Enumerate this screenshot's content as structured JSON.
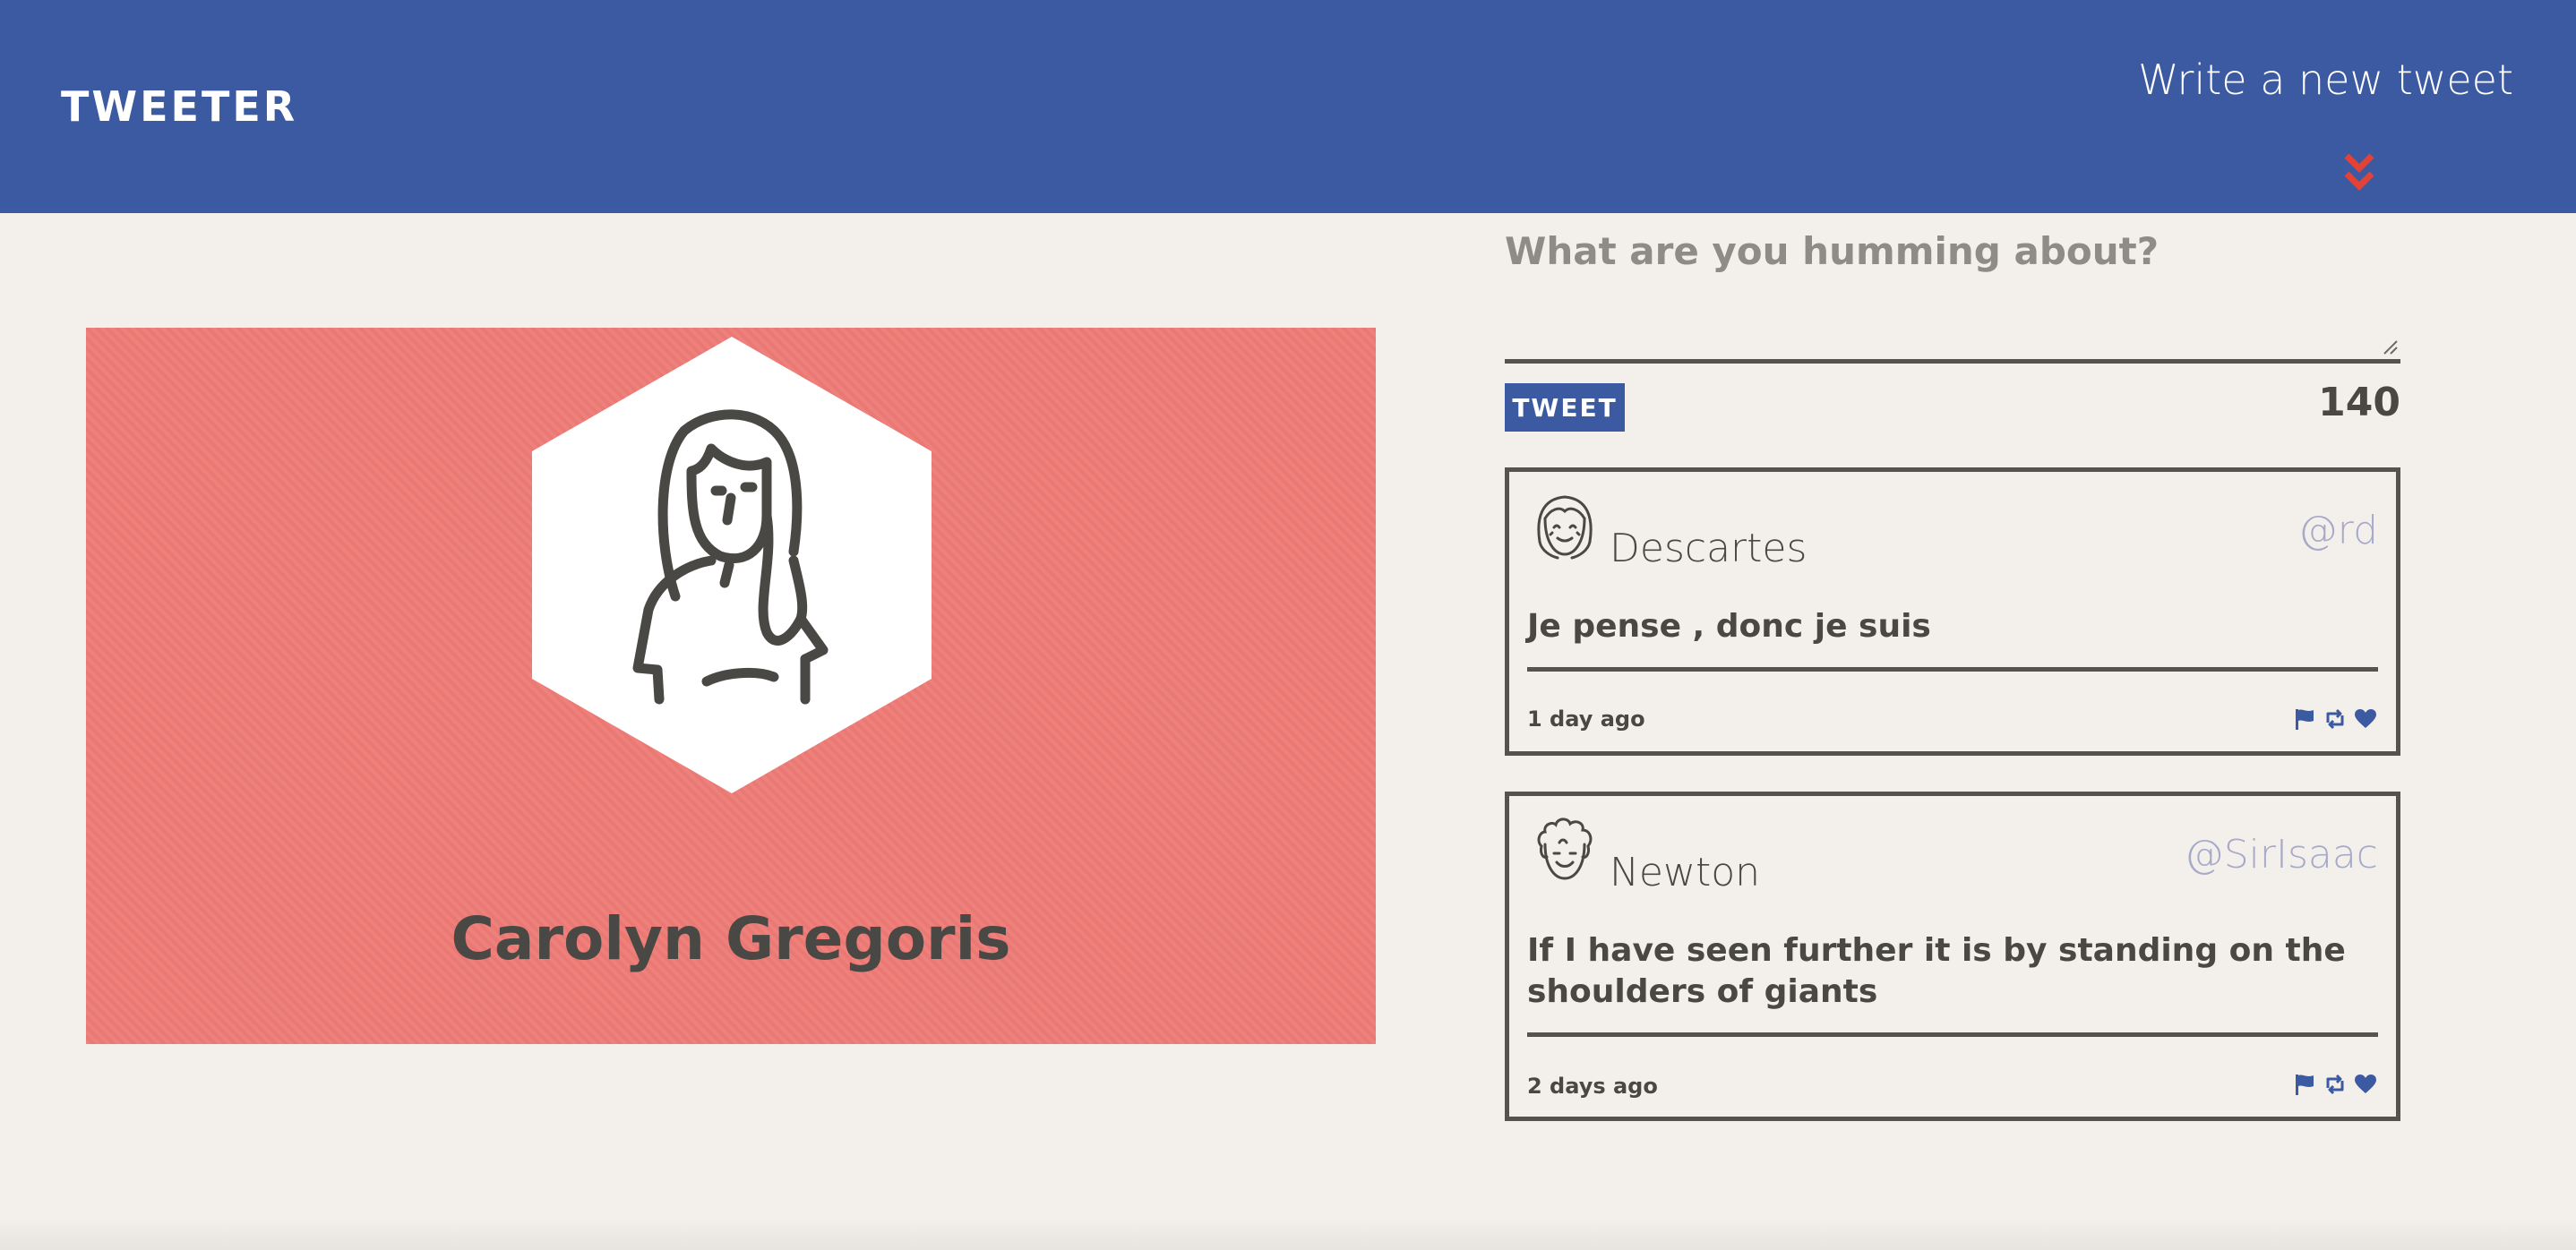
{
  "nav": {
    "logo": "TWEETER",
    "compose_toggle": "Write a new tweet",
    "chevron_icon": "double-chevron-down-icon",
    "chevron_color": "#e34336"
  },
  "profile": {
    "name": "Carolyn Gregoris",
    "avatar_icon": "woman-avatar-icon",
    "background_color": "#ee7b76"
  },
  "compose": {
    "placeholder": "What are you humming about?",
    "value": "",
    "button_label": "TWEET",
    "char_counter": "140"
  },
  "tweets": [
    {
      "author": "Descartes",
      "handle": "@rd",
      "avatar_icon": "smiling-person-avatar-icon",
      "text": "Je pense , donc je suis",
      "time": "1 day ago",
      "actions": [
        "flag-icon",
        "retweet-icon",
        "heart-icon"
      ]
    },
    {
      "author": "Newton",
      "handle": "@SirIsaac",
      "avatar_icon": "curly-hair-person-avatar-icon",
      "text": "If I have seen further it is by standing on the shoulders of giants",
      "time": "2 days ago",
      "actions": [
        "flag-icon",
        "retweet-icon",
        "heart-icon"
      ]
    }
  ],
  "colors": {
    "nav": "#3c5aa1",
    "page": "#f3f0ec",
    "text": "#4a4844",
    "handle": "#a6a9c8",
    "action": "#3c5aa1"
  }
}
